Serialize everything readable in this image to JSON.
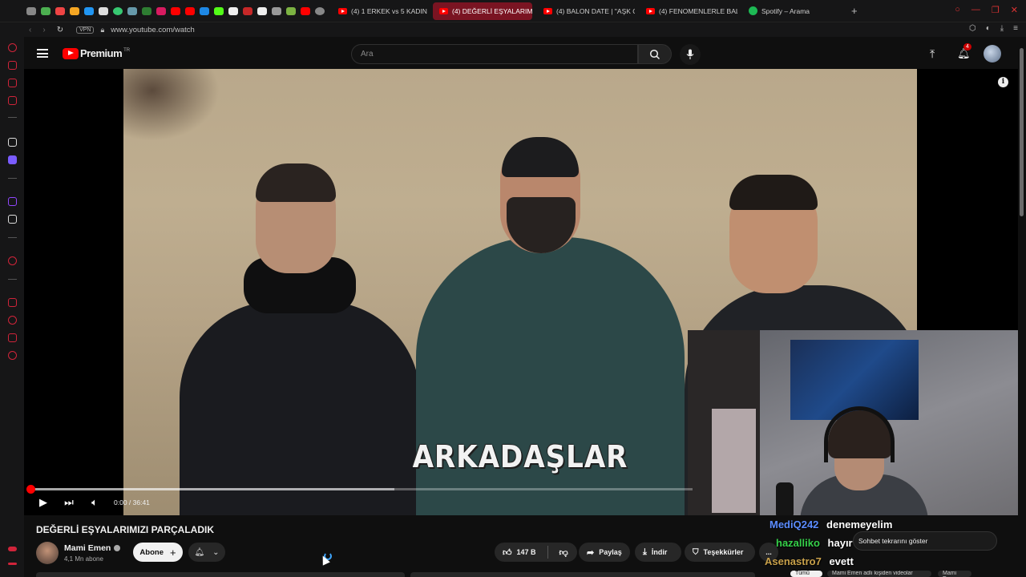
{
  "browser": {
    "tabs": [
      {
        "label": "(4) 1 ERKEK vs 5 KADIN |",
        "active": false,
        "icon": "youtube-icon"
      },
      {
        "label": "(4) DEĞERLİ EŞYALARIMI",
        "active": true,
        "icon": "youtube-icon"
      },
      {
        "label": "(4) BALON DATE | \"AŞK O",
        "active": false,
        "icon": "youtube-icon"
      },
      {
        "label": "(4) FENOMENLERLE BAL",
        "active": false,
        "icon": "youtube-icon"
      },
      {
        "label": "Spotify – Arama",
        "active": false,
        "icon": "spotify-icon"
      }
    ],
    "vpn_label": "VPN",
    "url": "www.youtube.com/watch"
  },
  "youtube_header": {
    "logo_text": "Premium",
    "region": "TR",
    "search_placeholder": "Ara",
    "notification_count": "4"
  },
  "video": {
    "caption_text": "ARKADAŞLAR",
    "current_time": "0:00",
    "duration": "36:41",
    "time_display": "0:00 / 36:41",
    "progress_fraction": 0.0,
    "buffered_fraction": 0.55
  },
  "details": {
    "title": "DEĞERLİ EŞYALARIMIZI PARÇALADIK",
    "channel_name": "Mami Emen",
    "subscribers": "4,1 Mn abone",
    "subscribe_label": "Abone",
    "likes": "147 B",
    "share_label": "Paylaş",
    "download_label": "İndir",
    "thanks_label": "Teşekkürler",
    "more_label": "...",
    "next_item_label": "Mami Emen adlı kişiden videolar"
  },
  "chat": {
    "messages": [
      {
        "user": "MediQ242",
        "message": "denemeyelim",
        "color": "#5b8cff"
      },
      {
        "user": "hazalliko",
        "message": "hayır",
        "color": "#35d049"
      },
      {
        "user": "Asenastro7",
        "message": "evett",
        "color": "#c9a14a"
      }
    ],
    "replay_label": "Sohbet tekrarını göster",
    "bottom_chip": "Tümü"
  },
  "colors": {
    "accent": "#ff0000",
    "opera_red": "#d0243a",
    "background": "#0f0f0f"
  }
}
